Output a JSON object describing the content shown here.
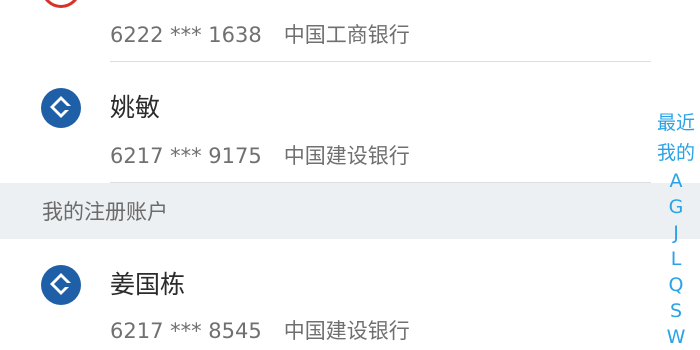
{
  "accounts_top": [
    {
      "bank_icon": "icbc-logo-icon",
      "number": "6222 *** 1638",
      "bank": "中国工商银行"
    },
    {
      "name": "姚敏",
      "bank_icon": "ccb-logo-icon",
      "number": "6217 *** 9175",
      "bank": "中国建设银行"
    }
  ],
  "section": {
    "title": "我的注册账户"
  },
  "accounts_registered": [
    {
      "name": "姜国栋",
      "bank_icon": "ccb-logo-icon",
      "number": "6217 *** 8545",
      "bank": "中国建设银行"
    }
  ],
  "index_bar": [
    "最近",
    "我的",
    "A",
    "G",
    "J",
    "L",
    "Q",
    "S",
    "W"
  ],
  "colors": {
    "accent": "#2aa3e6",
    "ccb_blue": "#1f5fa8",
    "icbc_red": "#d9302a",
    "section_bg": "#edf0f3"
  }
}
